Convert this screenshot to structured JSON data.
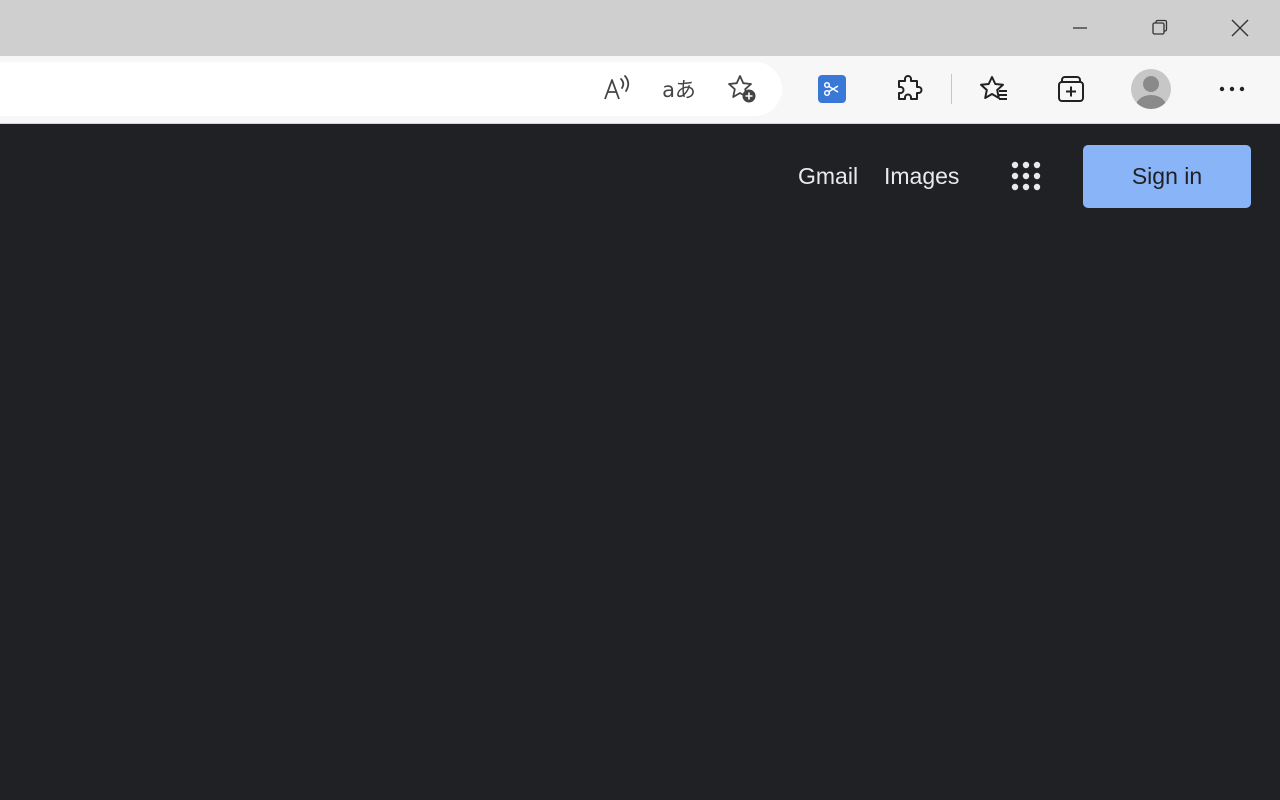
{
  "window": {
    "controls": [
      {
        "name": "minimize",
        "icon": "minimize-icon"
      },
      {
        "name": "restore",
        "icon": "restore-icon"
      },
      {
        "name": "close",
        "icon": "close-icon"
      }
    ]
  },
  "toolbar": {
    "icons": [
      "read-aloud-icon",
      "translate-icon",
      "add-favorite-icon",
      "web-capture-icon",
      "extensions-icon",
      "favorites-icon",
      "collections-icon",
      "profile-avatar-icon",
      "more-options-icon"
    ],
    "translate_glyph": "aあ",
    "accent_color": "#3a78d8"
  },
  "google": {
    "links": [
      {
        "label": "Gmail"
      },
      {
        "label": "Images"
      }
    ],
    "apps_icon": "google-apps-icon",
    "sign_in_label": "Sign in",
    "sign_in_color": "#8ab4f8",
    "background_color": "#202124"
  }
}
